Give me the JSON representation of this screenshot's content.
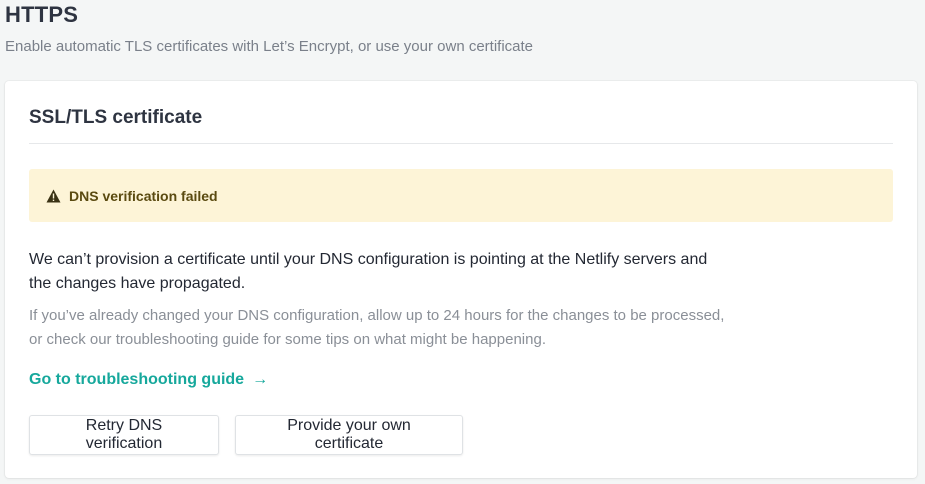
{
  "section": {
    "title": "HTTPS",
    "subtitle": "Enable automatic TLS certificates with Let’s Encrypt, or use your own certificate"
  },
  "card": {
    "title": "SSL/TLS certificate",
    "alert": {
      "icon": "warning-icon",
      "text": "DNS verification failed",
      "color": "#fdf4d7"
    },
    "message": "We can’t provision a certificate until your DNS configuration is pointing at the Netlify servers and the changes have propagated.",
    "help": "If you’ve already changed your DNS configuration, allow up to 24 hours for the changes to be processed, or check our troubleshooting guide for some tips on what might be happening.",
    "link": {
      "label": "Go to troubleshooting guide",
      "arrow": "→",
      "color": "#16a89c"
    },
    "buttons": {
      "retry": "Retry DNS verification",
      "provide": "Provide your own certificate"
    }
  }
}
